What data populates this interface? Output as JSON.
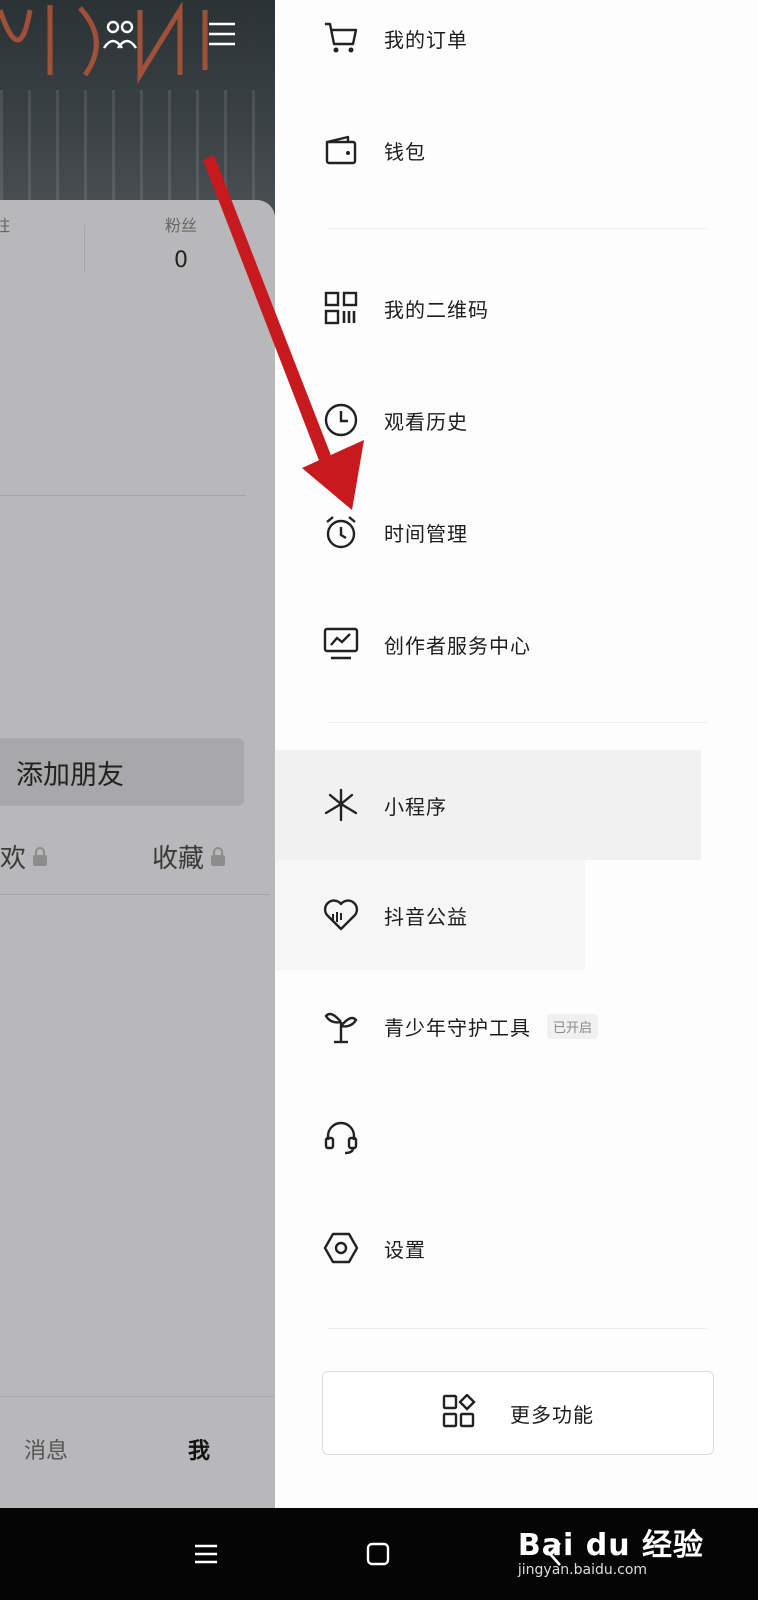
{
  "left_page": {
    "stats": [
      {
        "label": "柱",
        "value": ""
      },
      {
        "label": "粉丝",
        "value": "0"
      }
    ],
    "add_friend_label": "添加朋友",
    "tabs": [
      {
        "label": "欢"
      },
      {
        "label": "收藏"
      }
    ],
    "bottom_nav": [
      {
        "label": "消息"
      },
      {
        "label": "我"
      }
    ]
  },
  "drawer": {
    "items": [
      {
        "label": "我的订单",
        "icon": "cart-icon"
      },
      {
        "label": "钱包",
        "icon": "wallet-icon"
      },
      {
        "label": "我的二维码",
        "icon": "qr-code-icon"
      },
      {
        "label": "观看历史",
        "icon": "clock-icon"
      },
      {
        "label": "时间管理",
        "icon": "alarm-clock-icon"
      },
      {
        "label": "创作者服务中心",
        "icon": "monitor-chart-icon"
      },
      {
        "label": "小程序",
        "icon": "mini-program-icon"
      },
      {
        "label": "抖音公益",
        "icon": "charity-heart-icon"
      },
      {
        "label": "青少年守护工具",
        "icon": "sprout-icon",
        "badge": "已开启"
      },
      {
        "label": "",
        "icon": "headset-icon"
      },
      {
        "label": "设置",
        "icon": "settings-hexagon-icon"
      }
    ],
    "more_label": "更多功能"
  },
  "system_bar": {
    "watermark_top": "Bai du 经验",
    "watermark_bottom": "jingyan.baidu.com"
  },
  "colors": {
    "arrow": "#c8191e",
    "dim_overlay": "#b8b8ba",
    "drawer_bg": "#fdfdfd"
  }
}
